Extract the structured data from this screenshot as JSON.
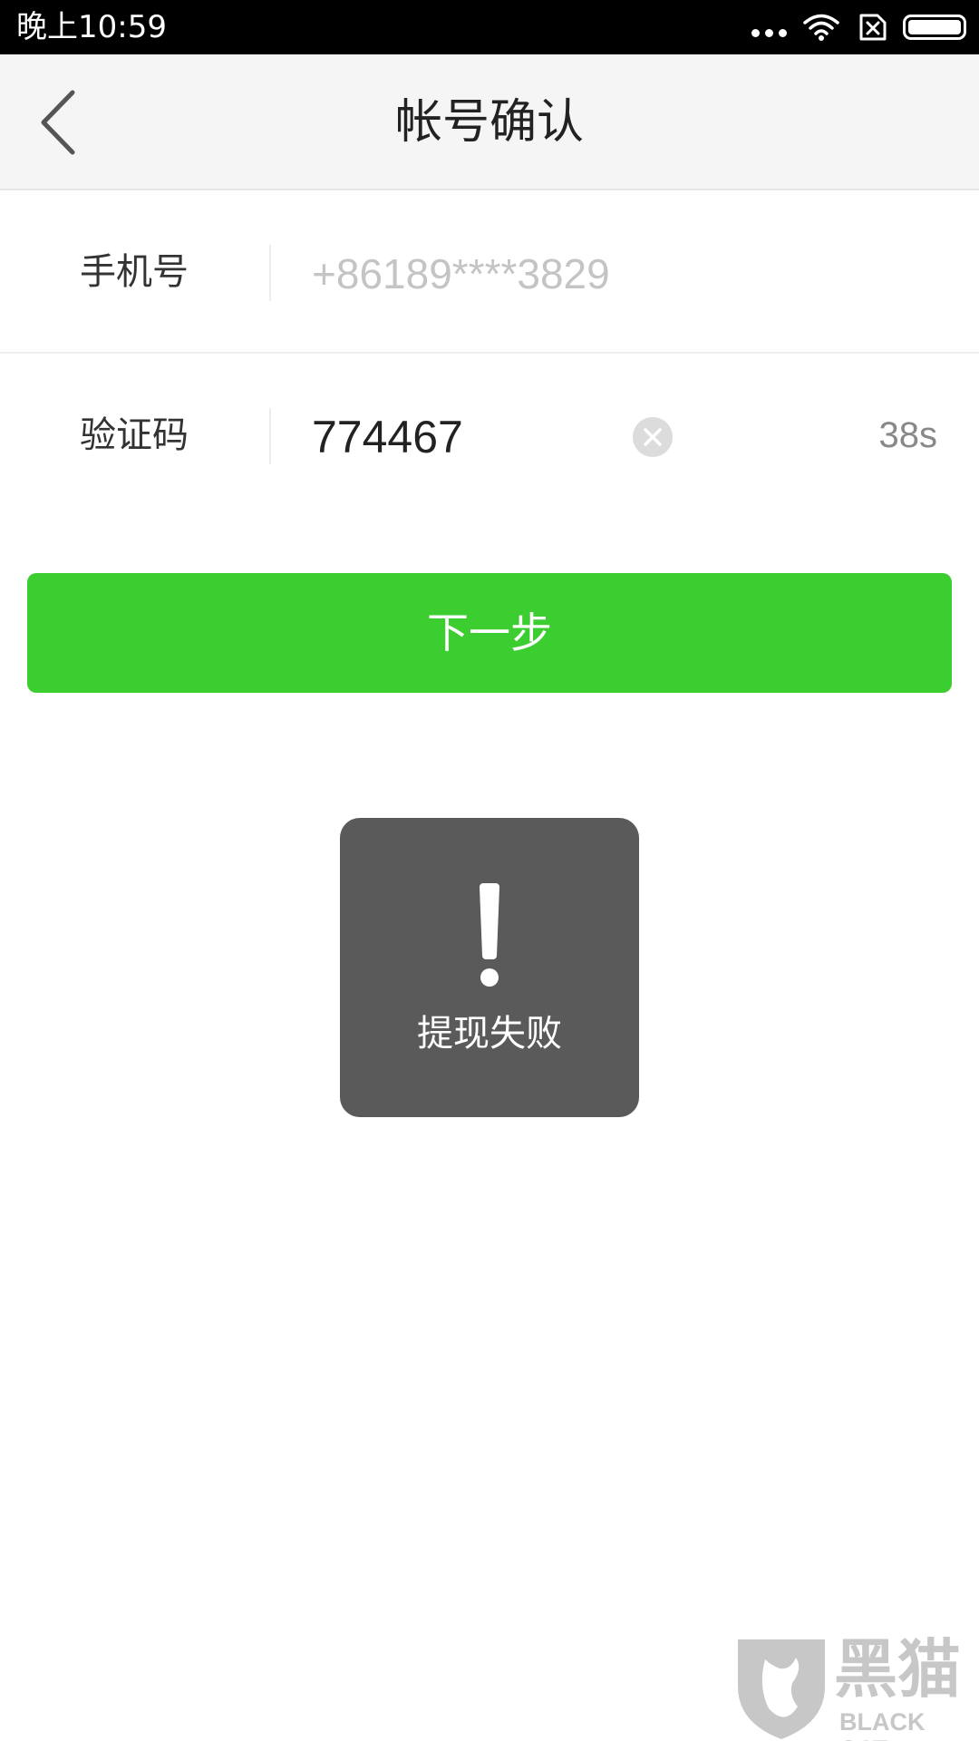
{
  "status_bar": {
    "time": "晚上10:59",
    "icons": [
      "more-dots-icon",
      "wifi-icon",
      "no-sim-icon",
      "battery-icon"
    ]
  },
  "nav": {
    "title": "帐号确认",
    "back_icon": "chevron-left-icon"
  },
  "form": {
    "phone_label": "手机号",
    "phone_value": "+86189****3829",
    "code_label": "验证码",
    "code_value": "774467",
    "countdown": "38s"
  },
  "next_button_label": "下一步",
  "toast": {
    "icon": "exclamation-icon",
    "message": "提现失败"
  },
  "watermark": {
    "text_cn": "黑猫",
    "text_en": "BLACK CAT"
  },
  "colors": {
    "accent_green": "#3cce30",
    "toast_bg": "#5a5a5a",
    "status_bar_bg": "#000000"
  }
}
